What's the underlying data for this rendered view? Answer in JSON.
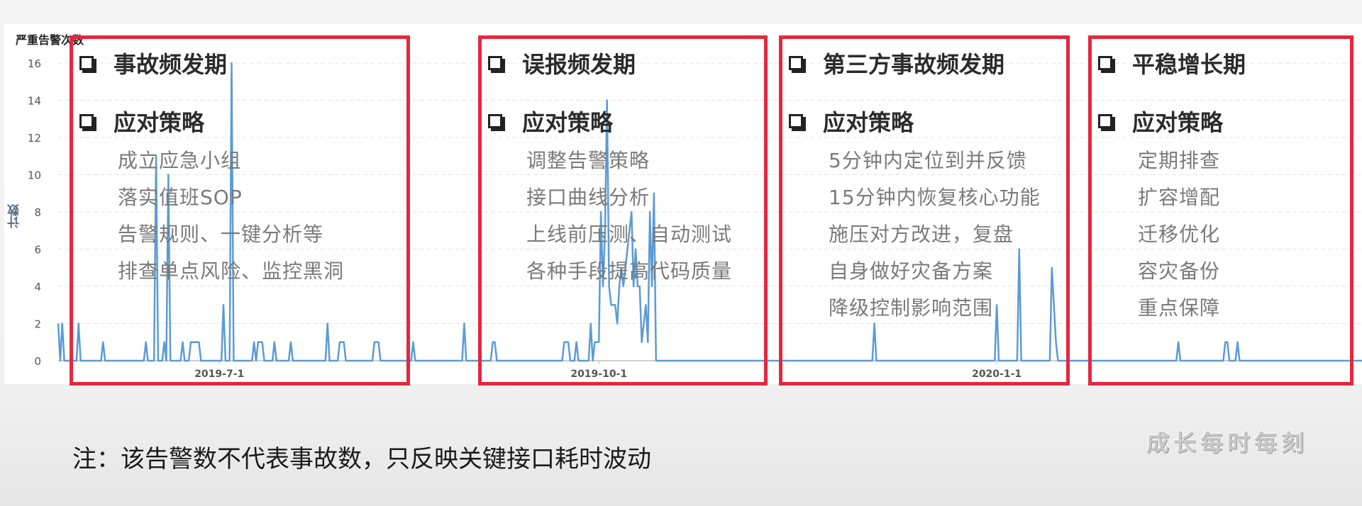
{
  "chart_data": {
    "type": "line",
    "title": "严重告警次数",
    "ylabel": "计数",
    "xlabel": "",
    "ylim": [
      0,
      16
    ],
    "yticks": [
      0,
      2,
      4,
      6,
      8,
      10,
      12,
      14,
      16
    ],
    "x_tick_labels": [
      {
        "label": "2019-7-1",
        "index": 79
      },
      {
        "label": "2019-10-1",
        "index": 265
      },
      {
        "label": "2020-1-1",
        "index": 460
      }
    ],
    "grid": true,
    "series": [
      {
        "color": "#5b9bd5",
        "values": [
          2,
          0,
          2,
          0,
          0,
          0,
          0,
          0,
          0,
          0,
          2,
          0,
          0,
          0,
          0,
          0,
          0,
          0,
          0,
          0,
          0,
          0,
          1,
          0,
          0,
          0,
          0,
          0,
          0,
          0,
          0,
          0,
          0,
          0,
          0,
          0,
          0,
          0,
          0,
          0,
          0,
          0,
          0,
          1,
          0,
          0,
          0,
          0,
          11,
          0,
          0,
          0,
          1,
          0,
          10,
          0,
          0,
          0,
          0,
          0,
          0,
          1,
          0,
          0,
          0,
          1,
          1,
          1,
          1,
          1,
          0,
          0,
          0,
          0,
          0,
          0,
          0,
          0,
          0,
          0,
          0,
          3,
          0,
          0,
          0,
          16,
          0,
          0,
          0,
          0,
          0,
          0,
          0,
          0,
          0,
          0,
          1,
          0,
          1,
          1,
          1,
          0,
          0,
          0,
          0,
          0,
          1,
          0,
          0,
          0,
          0,
          0,
          0,
          0,
          1,
          0,
          0,
          0,
          0,
          0,
          0,
          0,
          0,
          0,
          0,
          0,
          0,
          0,
          0,
          0,
          0,
          0,
          2,
          0,
          0,
          0,
          0,
          0,
          1,
          1,
          1,
          0,
          0,
          0,
          0,
          0,
          0,
          0,
          0,
          0,
          0,
          0,
          0,
          0,
          0,
          1,
          1,
          1,
          0,
          0,
          0,
          0,
          0,
          0,
          0,
          0,
          0,
          0,
          0,
          0,
          0,
          0,
          0,
          0,
          1,
          0,
          0,
          0,
          0,
          0,
          0,
          0,
          0,
          0,
          0,
          0,
          0,
          0,
          0,
          0,
          0,
          0,
          0,
          0,
          0,
          0,
          0,
          0,
          0,
          2,
          0,
          0,
          0,
          0,
          0,
          0,
          0,
          0,
          0,
          0,
          0,
          0,
          0,
          1,
          1,
          0,
          0,
          0,
          0,
          0,
          0,
          0,
          0,
          0,
          0,
          0,
          0,
          0,
          0,
          0,
          0,
          0,
          0,
          0,
          0,
          0,
          0,
          0,
          0,
          0,
          0,
          0,
          0,
          0,
          0,
          0,
          0,
          0,
          1,
          1,
          1,
          0,
          0,
          0,
          1,
          0,
          0,
          0,
          0,
          0,
          0,
          2,
          0,
          1,
          1,
          1,
          8,
          4,
          7,
          14,
          4,
          3,
          3,
          3,
          2,
          4,
          5,
          4,
          5,
          6,
          7,
          8,
          4,
          6,
          4,
          4,
          1,
          2,
          3,
          1,
          8,
          4,
          9,
          0,
          0,
          0,
          0,
          0,
          0,
          0,
          0,
          0,
          0,
          0,
          0,
          0,
          0,
          0,
          0,
          0,
          0,
          0,
          0,
          0,
          0,
          0,
          0,
          0,
          0,
          0,
          0,
          0,
          0,
          0,
          0,
          0,
          0,
          0,
          0,
          0,
          0,
          0,
          0,
          0,
          0,
          0,
          0,
          0,
          0,
          0,
          0,
          0,
          0,
          0,
          0,
          0,
          0,
          0,
          0,
          0,
          0,
          0,
          0,
          0,
          0,
          0,
          0,
          0,
          0,
          0,
          0,
          0,
          0,
          0,
          0,
          0,
          0,
          0,
          0,
          0,
          0,
          0,
          0,
          0,
          0,
          0,
          0,
          0,
          0,
          0,
          0,
          0,
          0,
          0,
          0,
          0,
          0,
          0,
          0,
          0,
          0,
          0,
          0,
          0,
          0,
          0,
          0,
          0,
          0,
          0,
          2,
          0,
          0,
          0,
          0,
          0,
          0,
          0,
          0,
          0,
          0,
          0,
          0,
          0,
          0,
          0,
          0,
          0,
          0,
          0,
          0,
          0,
          0,
          0,
          0,
          0,
          0,
          0,
          0,
          0,
          0,
          0,
          0,
          0,
          0,
          0,
          0,
          0,
          0,
          0,
          0,
          0,
          0,
          0,
          0,
          0,
          0,
          0,
          0,
          0,
          0,
          0,
          0,
          0,
          0,
          0,
          0,
          0,
          0,
          0,
          3,
          0,
          0,
          0,
          0,
          0,
          0,
          0,
          0,
          0,
          0,
          6,
          0,
          0,
          0,
          0,
          0,
          0,
          0,
          0,
          0,
          0,
          0,
          0,
          0,
          0,
          0,
          5,
          3,
          1,
          0,
          0,
          0,
          0,
          0,
          0,
          0,
          0,
          0,
          0,
          0,
          0,
          0,
          0,
          0,
          0,
          0,
          0,
          0,
          0,
          0,
          0,
          0,
          0,
          0,
          0,
          0,
          0,
          0,
          0,
          0,
          0,
          0,
          0,
          0,
          0,
          0,
          0,
          0,
          0,
          0,
          0,
          0,
          0,
          0,
          0,
          0,
          0,
          0,
          0,
          0,
          0,
          0,
          0,
          0,
          0,
          0,
          0,
          0,
          1,
          0,
          0,
          0,
          0,
          0,
          0,
          0,
          0,
          0,
          0,
          0,
          0,
          0,
          0,
          0,
          0,
          0,
          0,
          0,
          0,
          0,
          0,
          1,
          1,
          0,
          0,
          0,
          0,
          1,
          0,
          0,
          0,
          0,
          0,
          0,
          0,
          0,
          0,
          0,
          0,
          0,
          0,
          0,
          0,
          0,
          0,
          0,
          0,
          0,
          0,
          0,
          0,
          0,
          0,
          0,
          0,
          0,
          0,
          0,
          0,
          0,
          0,
          0,
          0,
          0,
          0,
          0,
          0,
          0,
          0,
          0,
          0,
          0,
          0,
          0,
          0,
          0,
          0,
          0,
          0,
          0,
          0,
          0,
          0,
          0,
          0,
          0,
          0,
          0,
          0
        ]
      }
    ]
  },
  "phases": [
    {
      "title": "事故频发期",
      "strategy_title": "应对策略",
      "items": [
        "成立应急小组",
        "落实值班SOP",
        "告警规则、一键分析等",
        "排查单点风险、监控黑洞"
      ]
    },
    {
      "title": "误报频发期",
      "strategy_title": "应对策略",
      "items": [
        "调整告警策略",
        "接口曲线分析",
        "上线前压测、自动测试",
        "各种手段提高代码质量"
      ]
    },
    {
      "title": "第三方事故频发期",
      "strategy_title": "应对策略",
      "items": [
        "5分钟内定位到并反馈",
        "15分钟内恢复核心功能",
        "施压对方改进，复盘",
        "自身做好灾备方案",
        "降级控制影响范围"
      ]
    },
    {
      "title": "平稳增长期",
      "strategy_title": "应对策略",
      "items": [
        "定期排查",
        "扩容增配",
        "迁移优化",
        "容灾备份",
        "重点保障"
      ]
    }
  ],
  "note": "注：该告警数不代表事故数，只反映关键接口耗时波动",
  "watermark": "成长每时每刻",
  "colors": {
    "accent": "#e3283e",
    "series": "#5b9bd5"
  }
}
